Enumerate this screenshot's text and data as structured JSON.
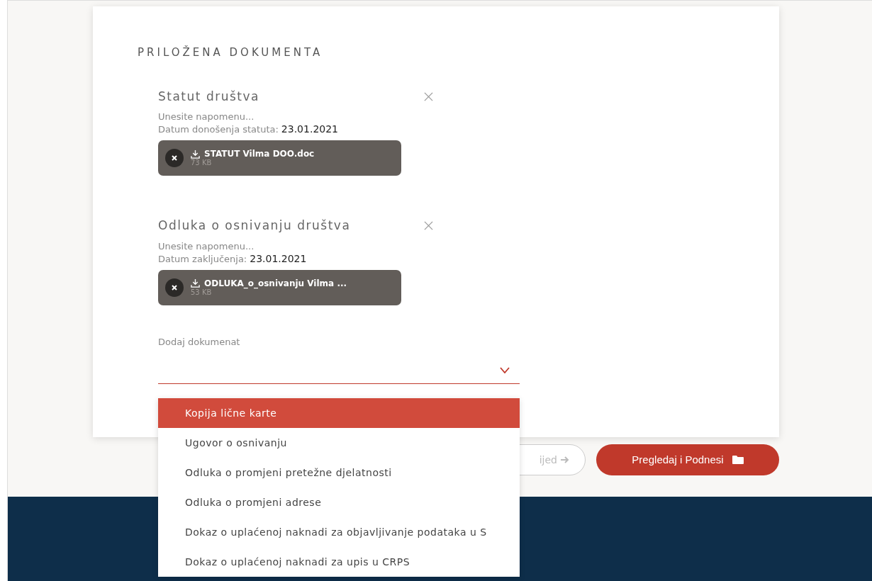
{
  "section_title": "PRILOŽENA DOKUMENTA",
  "documents": [
    {
      "title": "Statut društva",
      "note_placeholder": "Unesite napomenu...",
      "date_label": "Datum donošenja statuta:",
      "date_value": "23.01.2021",
      "file": {
        "name": "STATUT Vilma DOO.doc",
        "size": "73 KB"
      }
    },
    {
      "title": "Odluka o osnivanju društva",
      "note_placeholder": "Unesite napomenu...",
      "date_label": "Datum zaključenja:",
      "date_value": "23.01.2021",
      "file": {
        "name": "ODLUKA_o_osnivanju Vilma ...",
        "size": "53 KB"
      }
    }
  ],
  "add_document": {
    "label": "Dodaj dokumenat",
    "expanded": true,
    "options": [
      {
        "label": "Kopija lične karte",
        "selected": true
      },
      {
        "label": "Ugovor o osnivanju",
        "selected": false
      },
      {
        "label": "Odluka o promjeni pretežne djelatnosti",
        "selected": false
      },
      {
        "label": "Odluka o promjeni adrese",
        "selected": false
      },
      {
        "label": "Dokaz o uplaćenoj naknadi za objavljivanje podataka u S",
        "selected": false
      },
      {
        "label": "Dokaz o uplaćenoj naknadi za upis u CRPS",
        "selected": false
      }
    ]
  },
  "buttons": {
    "next": "ijed",
    "submit": "Pregledaj i Podnesi"
  }
}
